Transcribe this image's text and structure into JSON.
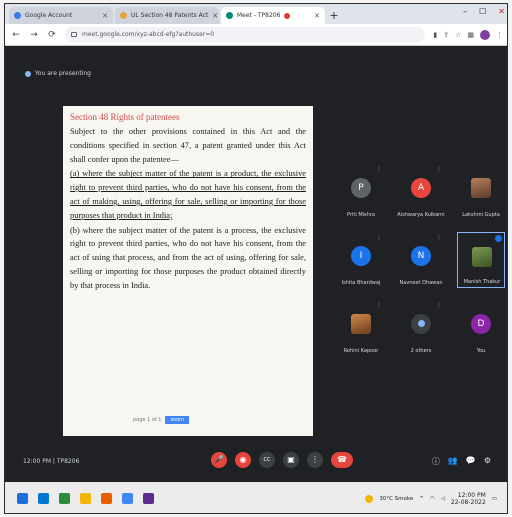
{
  "browser": {
    "tabs": [
      {
        "label": "Google Account",
        "active": false
      },
      {
        "label": "UL Section 48 Patents Act",
        "active": false
      },
      {
        "label": "Meet - TP8206",
        "active": true,
        "recording": true
      }
    ],
    "new_tab_symbol": "+",
    "url": "meet.google.com/xyz-abcd-efg?authuser=0",
    "window_controls": {
      "minimize": "–",
      "maximize": "☐",
      "close": "✕"
    }
  },
  "meet": {
    "presenter_label": "You are presenting",
    "document": {
      "heading": "Section 48 Rights of patentees",
      "paragraphs": [
        "Subject to the other provisions contained in this Act and the conditions specified in section 47, a patent granted under this Act shall confer upon the patentee—",
        "(a) where the subject matter of the patent is a product, the exclusive right to prevent third parties, who do not have his consent, from the act of making, using, offering for sale, selling or importing for those purposes that product in India;",
        "(b) where the subject matter of the patent is a process, the exclusive right to prevent third parties, who do not have his consent, from the act of using that process, and from the act of using, offering for sale, selling or importing for those purposes the product obtained directly by that process in India."
      ],
      "footer_text": "page 1 of 1",
      "footer_highlight": "zoom"
    },
    "participants": [
      {
        "name": "Priti Mishra",
        "initial": "P",
        "color": "#5f6368"
      },
      {
        "name": "Aishwarya Kulkarni",
        "initial": "A",
        "color": "#e8453c"
      },
      {
        "name": "Lakshmi Gupta",
        "initial": "",
        "color": "#a4654a",
        "photo": true
      },
      {
        "name": "Ishita Bhardwaj",
        "initial": "I",
        "color": "#1a73e8"
      },
      {
        "name": "Navneet Dhawan",
        "initial": "N",
        "color": "#1a73e8"
      },
      {
        "name": "Manish Thakur",
        "initial": "",
        "color": "#5b7b3a",
        "photo": true,
        "active": true
      },
      {
        "name": "Rohini Kapoor",
        "initial": "",
        "color": "#c2723c",
        "photo": true
      },
      {
        "name": "2 others",
        "initial": "",
        "color": "#3c4043"
      },
      {
        "name": "You",
        "initial": "D",
        "color": "#8e24aa"
      }
    ],
    "meeting_info": "12:00 PM | TP8206",
    "controls": {
      "mic": "🎤",
      "cam": "◉",
      "captions": "CC",
      "present": "▣",
      "more": "⋮",
      "leave": "☎"
    },
    "side_controls": {
      "info": "ⓘ",
      "people": "👥",
      "chat": "💬",
      "activities": "⚙"
    }
  },
  "taskbar": {
    "apps": [
      "#1e6fd9",
      "#0078d4",
      "#2c8c3c",
      "#f2b705",
      "#e66000",
      "#4285f4",
      "#5c2d91"
    ],
    "weather": "30°C Smoke",
    "time": "12:00 PM",
    "date": "22-08-2022"
  }
}
